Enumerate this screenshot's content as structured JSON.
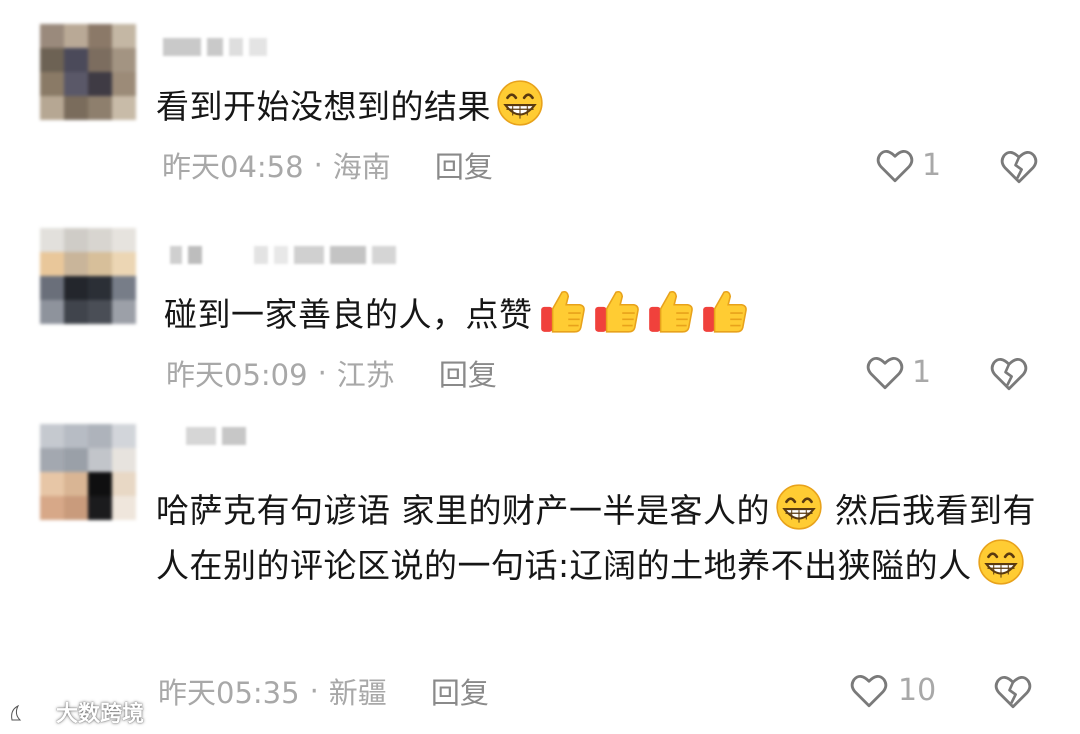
{
  "comments": [
    {
      "text": "看到开始没想到的结果",
      "time": "昨天04:58",
      "separator": "·",
      "region": "海南",
      "reply_label": "回复",
      "like_count": "1",
      "emoji": [
        "grin-emoji"
      ]
    },
    {
      "text": "碰到一家善良的人，点赞",
      "time": "昨天05:09",
      "separator": "·",
      "region": "江苏",
      "reply_label": "回复",
      "like_count": "1",
      "emoji": [
        "thumbs-up-emoji",
        "thumbs-up-emoji",
        "thumbs-up-emoji",
        "thumbs-up-emoji"
      ]
    },
    {
      "text_part1": "哈萨克有句谚语  家里的财产一半是客人的",
      "text_part2": " 然后我看到有人在别的评论区说的一句话:辽阔的土地养不出狭隘的人",
      "time": "昨天05:35",
      "separator": "·",
      "region": "新疆",
      "reply_label": "回复",
      "like_count": "10",
      "emoji": [
        "grin-emoji",
        "grin-emoji"
      ]
    }
  ],
  "watermark": {
    "text": "大数跨境",
    "icon": "brand-logo-icon"
  },
  "icons": {
    "like": "heart-outline-icon",
    "dislike": "broken-heart-icon"
  },
  "colors": {
    "meta_gray": "#a8a8a8",
    "reply_gray": "#8a8a8a",
    "emoji_yellow": "#ffcc33",
    "thumb_red": "#f0413c"
  }
}
